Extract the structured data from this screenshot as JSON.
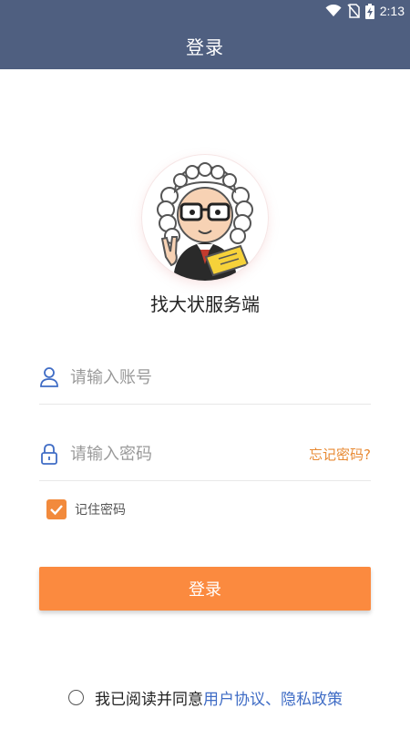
{
  "status_bar": {
    "time": "2:13"
  },
  "appbar": {
    "title": "登录"
  },
  "app": {
    "name": "找大状服务端"
  },
  "form": {
    "account_placeholder": "请输入账号",
    "password_placeholder": "请输入密码",
    "forgot_label": "忘记密码?",
    "remember_label": "记住密码",
    "remember_checked": true,
    "login_label": "登录"
  },
  "agreement": {
    "prefix": "我已阅读并同意",
    "user_agreement": "用户协议",
    "separator": "、",
    "privacy_policy": "隐私政策"
  },
  "colors": {
    "header": "#4f5f80",
    "accent": "#fb8a3f",
    "link": "#3f6cc5"
  }
}
